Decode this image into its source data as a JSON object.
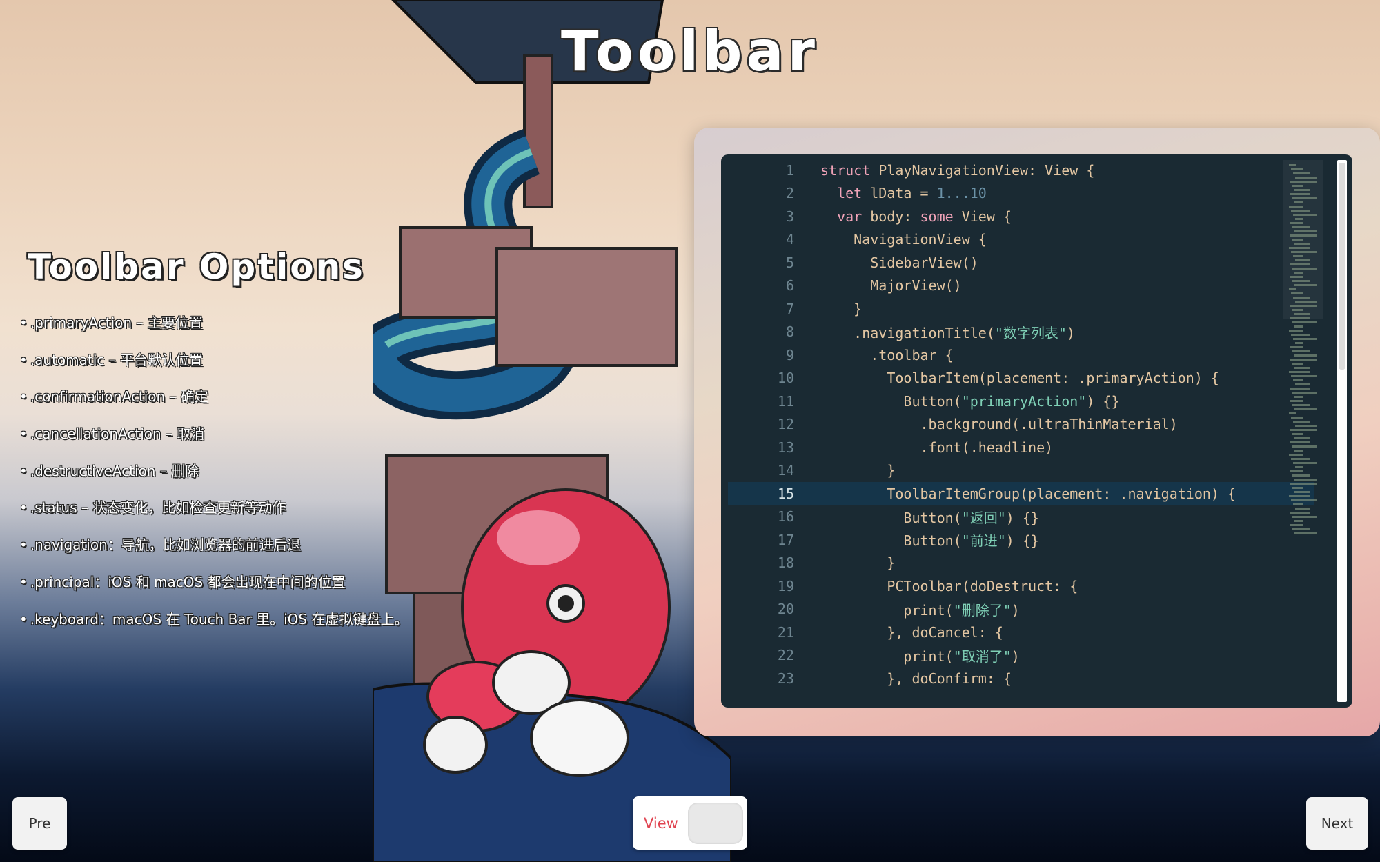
{
  "title": "Toolbar",
  "options": {
    "title": "Toolbar Options",
    "items": [
      ".primaryAction – 主要位置",
      ".automatic – 平台默认位置",
      ".confirmationAction – 确定",
      ".cancellationAction – 取消",
      ".destructiveAction – 删除",
      ".status – 状态变化，比如检查更新等动作",
      ".navigation：导航，比如浏览器的前进后退",
      ".principal：iOS 和 macOS 都会出现在中间的位置",
      ".keyboard：macOS 在 Touch Bar 里。iOS 在虚拟键盘上。"
    ]
  },
  "code": {
    "active_line": 15,
    "lines": [
      {
        "n": "1",
        "text": "struct PlayNavigationView: View {"
      },
      {
        "n": "2",
        "text": "  let lData = 1...10"
      },
      {
        "n": "3",
        "text": "  var body: some View {"
      },
      {
        "n": "4",
        "text": "    NavigationView {"
      },
      {
        "n": "5",
        "text": "      SidebarView()"
      },
      {
        "n": "6",
        "text": "      MajorView()"
      },
      {
        "n": "7",
        "text": "    }"
      },
      {
        "n": "8",
        "text": "    .navigationTitle(\"数字列表\")"
      },
      {
        "n": "9",
        "text": "      .toolbar {"
      },
      {
        "n": "10",
        "text": "        ToolbarItem(placement: .primaryAction) {"
      },
      {
        "n": "11",
        "text": "          Button(\"primaryAction\") {}"
      },
      {
        "n": "12",
        "text": "            .background(.ultraThinMaterial)"
      },
      {
        "n": "13",
        "text": "            .font(.headline)"
      },
      {
        "n": "14",
        "text": "        }"
      },
      {
        "n": "15",
        "text": "        ToolbarItemGroup(placement: .navigation) {"
      },
      {
        "n": "16",
        "text": "          Button(\"返回\") {}"
      },
      {
        "n": "17",
        "text": "          Button(\"前进\") {}"
      },
      {
        "n": "18",
        "text": "        }"
      },
      {
        "n": "19",
        "text": "        PCToolbar(doDestruct: {"
      },
      {
        "n": "20",
        "text": "          print(\"删除了\")"
      },
      {
        "n": "21",
        "text": "        }, doCancel: {"
      },
      {
        "n": "22",
        "text": "          print(\"取消了\")"
      },
      {
        "n": "23",
        "text": "        }, doConfirm: {"
      }
    ]
  },
  "buttons": {
    "pre": "Pre",
    "next": "Next",
    "view": "View"
  },
  "colors": {
    "accent_red": "#e0424f",
    "editor_bg": "#1a2a33",
    "active_line_bg": "#15354a"
  }
}
